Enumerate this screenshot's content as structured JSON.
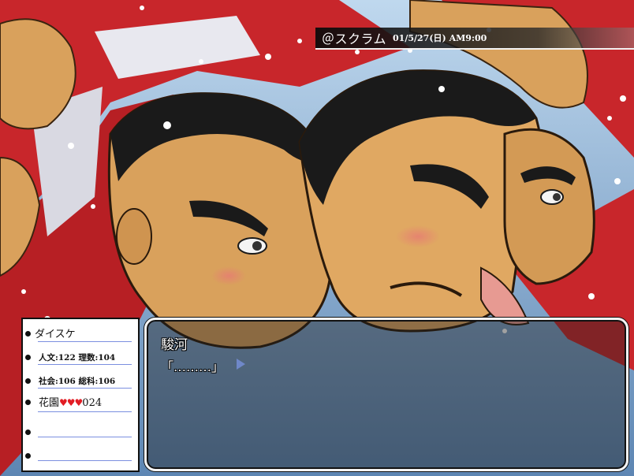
{
  "banner": {
    "location": "＠スクラム",
    "datetime": "01/5/27(日) AM9:00"
  },
  "status": {
    "character_name": "ダイスケ",
    "stats_row1": "人文:122 理数:104",
    "stats_row2": "社会:106 総科:106",
    "girl_name": "花園",
    "hearts": "♥♥♥",
    "affection": "024"
  },
  "dialogue": {
    "speaker": "駿河",
    "text": "「………」",
    "next_icon": "next-arrow-icon"
  },
  "colors": {
    "heart": "#e21d24",
    "rule_line": "#7b8fe0",
    "next_arrow": "#6f88c9",
    "jersey_red": "#c8262b",
    "skin": "#d9a15c",
    "hair": "#1a1a1a"
  }
}
